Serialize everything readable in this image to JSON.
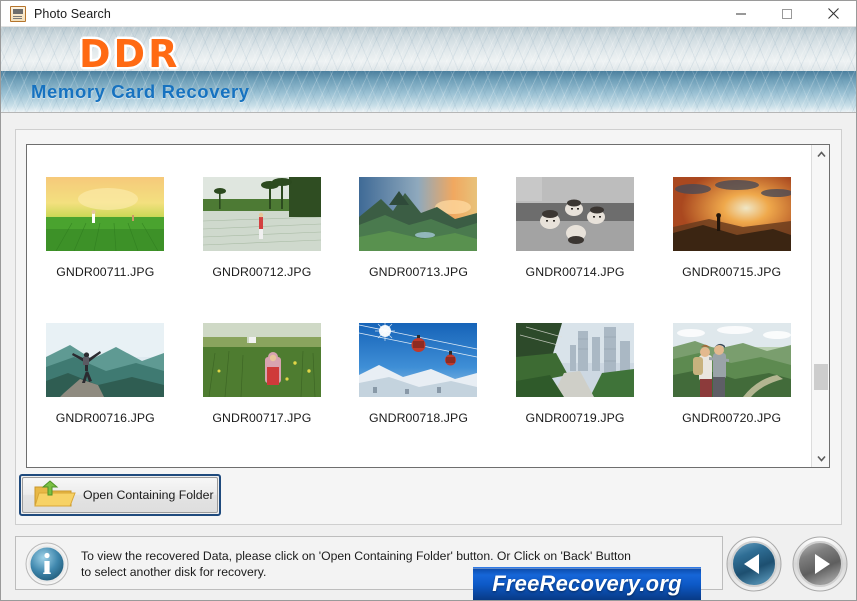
{
  "window": {
    "title": "Photo Search",
    "app_icon": "photo-document-icon",
    "controls": {
      "minimize": "–",
      "maximize": "□",
      "close": "✕"
    }
  },
  "banner": {
    "logo": "DDR",
    "tagline": "Memory Card Recovery",
    "logo_color": "#ff6a13",
    "tagline_color": "#1672c0"
  },
  "thumbnails": [
    {
      "name": "GNDR00711.JPG",
      "scene": "rice-field-sunrise"
    },
    {
      "name": "GNDR00712.JPG",
      "scene": "paddy-field-palms"
    },
    {
      "name": "GNDR00713.JPG",
      "scene": "mountain-valley-sunset"
    },
    {
      "name": "GNDR00714.JPG",
      "scene": "children-lying-bw"
    },
    {
      "name": "GNDR00715.JPG",
      "scene": "hiker-sunset-cliff"
    },
    {
      "name": "GNDR00716.JPG",
      "scene": "woman-mountain-peak"
    },
    {
      "name": "GNDR00717.JPG",
      "scene": "woman-in-crop-field"
    },
    {
      "name": "GNDR00718.JPG",
      "scene": "cable-car-snow"
    },
    {
      "name": "GNDR00719.JPG",
      "scene": "city-green-walkway"
    },
    {
      "name": "GNDR00720.JPG",
      "scene": "couple-viewpoint"
    }
  ],
  "actions": {
    "open_folder_label": "Open Containing Folder",
    "open_folder_icon": "folder-upload-icon",
    "focus_color": "#1f4a7d"
  },
  "scrollbar": {
    "up_icon": "chevron-up-icon",
    "down_icon": "chevron-down-icon",
    "thumb_position": "near-bottom"
  },
  "status": {
    "icon": "info-icon",
    "message": "To view the recovered Data, please click on 'Open Containing Folder' button. Or Click on 'Back' Button to select another disk for recovery."
  },
  "watermark": {
    "text": "FreeRecovery.org",
    "color": "#1666d8"
  },
  "navigation": {
    "back": {
      "icon": "back-arrow-icon",
      "state": "enabled",
      "color": "#2a6f9e"
    },
    "next": {
      "icon": "forward-arrow-icon",
      "state": "disabled",
      "color": "#8a8a8a"
    }
  }
}
